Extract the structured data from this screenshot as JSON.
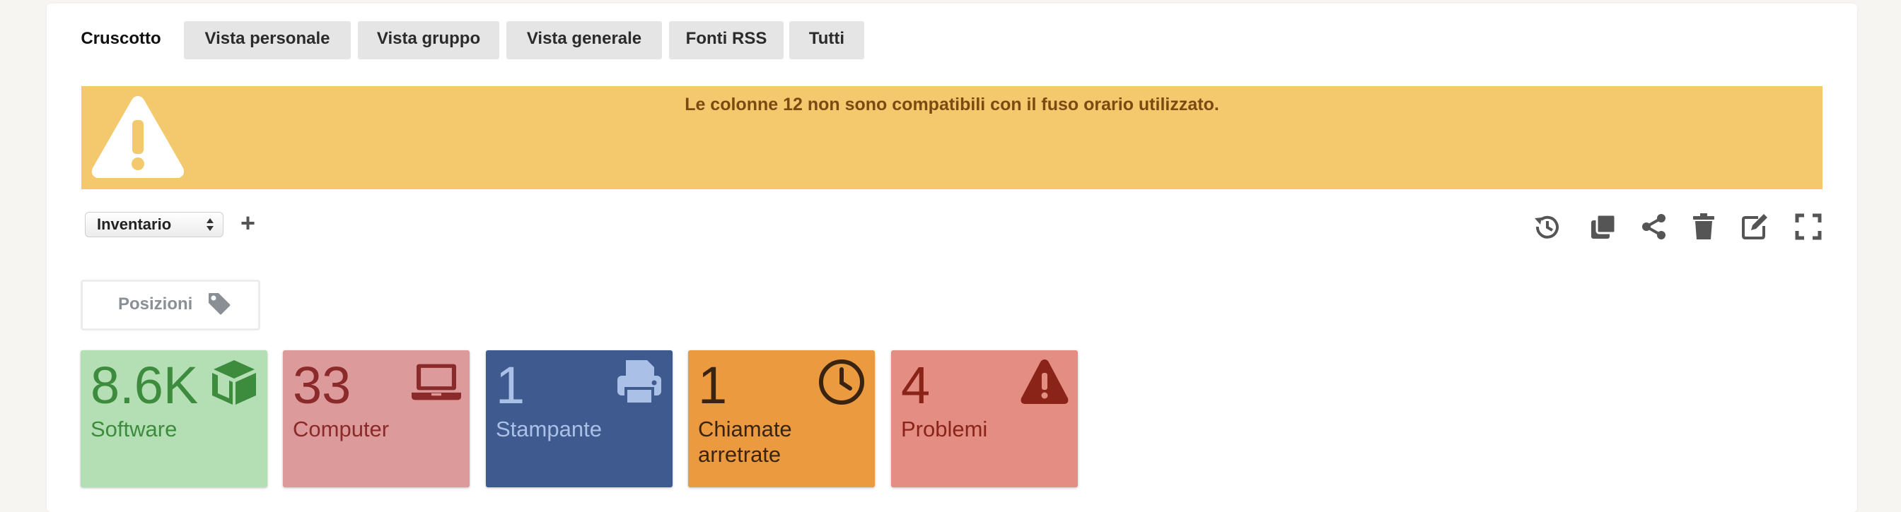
{
  "tabs": [
    {
      "label": "Cruscotto"
    },
    {
      "label": "Vista personale"
    },
    {
      "label": "Vista gruppo"
    },
    {
      "label": "Vista generale"
    },
    {
      "label": "Fonti RSS"
    },
    {
      "label": "Tutti"
    }
  ],
  "banner": {
    "message": "Le colonne 12 non sono compatibili con il fuso orario utilizzato.",
    "icon": "warning-triangle-icon",
    "color": "#f4c96d"
  },
  "dashboard_select": {
    "value": "Inventario"
  },
  "toolbar": {
    "icons": [
      "history-icon",
      "clone-icon",
      "share-icon",
      "trash-icon",
      "edit-icon",
      "fullscreen-icon"
    ]
  },
  "filter": {
    "label": "Posizioni",
    "icon": "tag-icon"
  },
  "cards": [
    {
      "value": "8.6K",
      "label": "Software",
      "icon": "box-icon",
      "bg": "#b4dfb4",
      "fg": "#3d8b3d"
    },
    {
      "value": "33",
      "label": "Computer",
      "icon": "laptop-icon",
      "bg": "#dd9a9a",
      "fg": "#8b2a2a"
    },
    {
      "value": "1",
      "label": "Stampante",
      "icon": "printer-icon",
      "bg": "#3e5a8e",
      "fg": "#aac0e6"
    },
    {
      "value": "1",
      "label": "Chiamate arretrate",
      "icon": "clock-icon",
      "bg": "#ec9a40",
      "fg": "#3a2410"
    },
    {
      "value": "4",
      "label": "Problemi",
      "icon": "alert-icon",
      "bg": "#e48e83",
      "fg": "#8b2418"
    }
  ]
}
